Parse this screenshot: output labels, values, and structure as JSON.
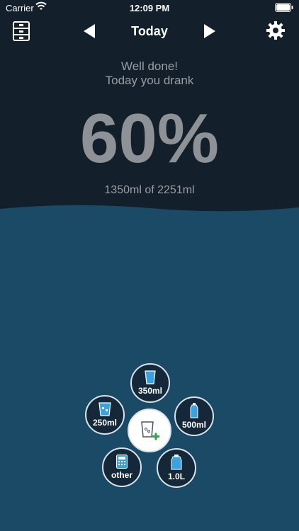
{
  "status": {
    "carrier": "Carrier",
    "time": "12:09 PM"
  },
  "nav": {
    "title": "Today"
  },
  "summary": {
    "line1": "Well done!",
    "line2": "Today you drank",
    "percent": "60%",
    "amount": "1350ml of 2251ml"
  },
  "quick_add": {
    "c350": "350ml",
    "c250": "250ml",
    "c500": "500ml",
    "other": "other",
    "c1l": "1.0L"
  },
  "colors": {
    "top_bg": "#131f2b",
    "water": "#1b4a66",
    "accent_green": "#2aa84a",
    "glass_blue": "#3aa3df"
  }
}
